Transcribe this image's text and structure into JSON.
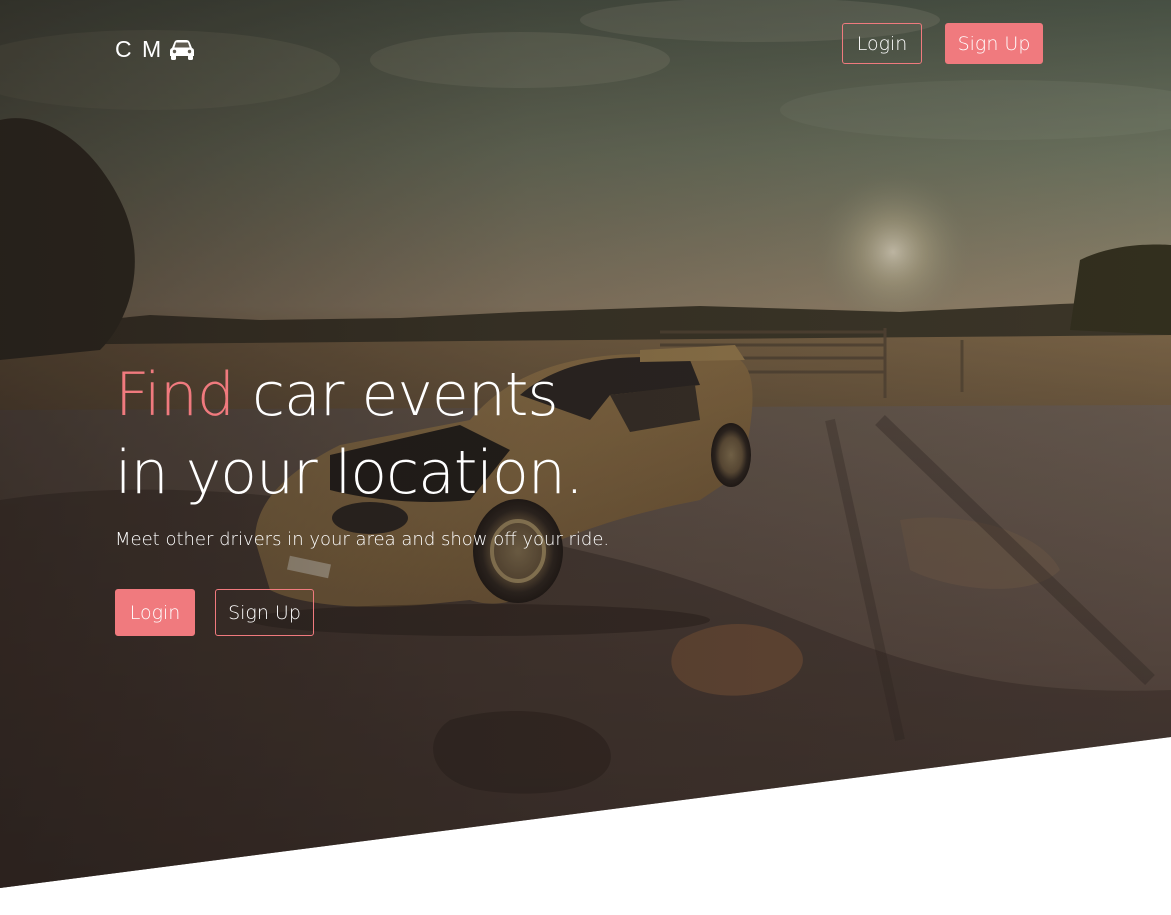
{
  "brand": {
    "logo_text": "C M",
    "logo_icon": "car-icon"
  },
  "nav": {
    "login_label": "Login",
    "signup_label": "Sign Up"
  },
  "hero": {
    "headline_accent": "Find",
    "headline_rest": " car events",
    "headline_line2": "in your location.",
    "subtitle": "Meet other drivers in your area and show off your ride.",
    "login_label": "Login",
    "signup_label": "Sign Up"
  },
  "colors": {
    "accent": "#f07a7e",
    "text": "#ffffff",
    "background": "#ffffff"
  }
}
